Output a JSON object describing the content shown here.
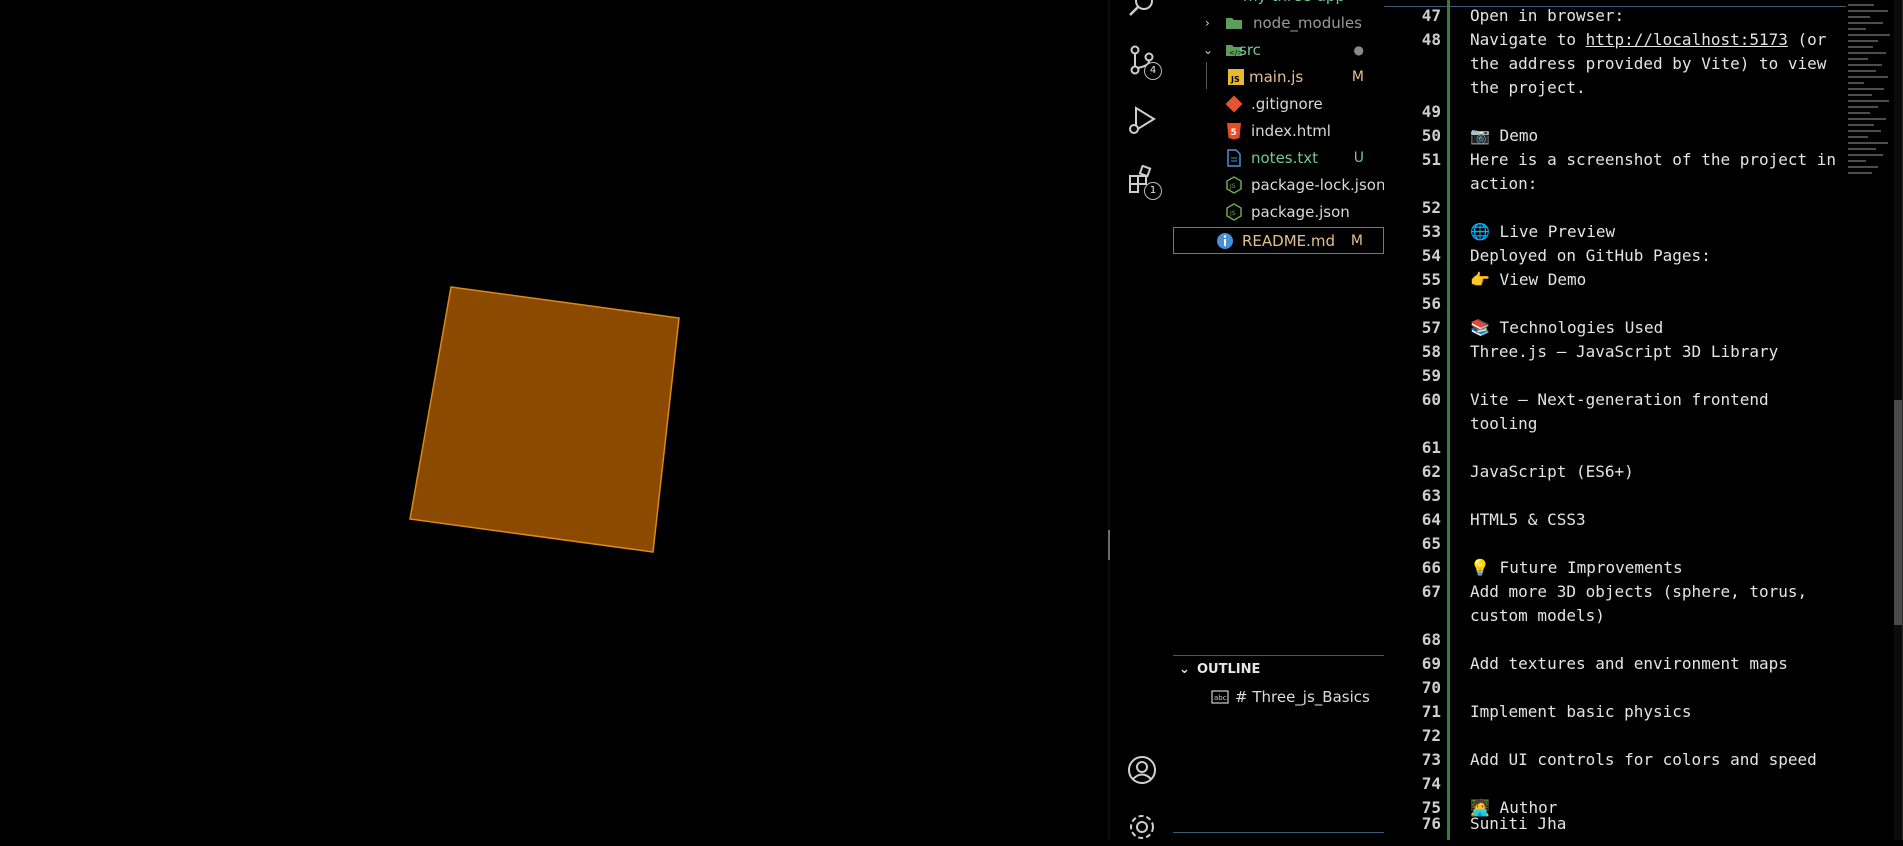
{
  "explorer": {
    "root_label": "my-three-app",
    "items": [
      {
        "label": "node_modules",
        "color": "#9a9a9a",
        "decoration": "",
        "kind": "folder"
      },
      {
        "label": "src",
        "color": "#73c991",
        "decoration": "●",
        "kind": "folder-open"
      },
      {
        "label": "main.js",
        "color": "#e2c08d",
        "decoration": "M",
        "kind": "js"
      },
      {
        "label": ".gitignore",
        "color": "#d8d8d8",
        "decoration": "",
        "kind": "git"
      },
      {
        "label": "index.html",
        "color": "#d8d8d8",
        "decoration": "",
        "kind": "html"
      },
      {
        "label": "notes.txt",
        "color": "#73c991",
        "decoration": "U",
        "kind": "txt"
      },
      {
        "label": "package-lock.json",
        "color": "#d8d8d8",
        "decoration": "",
        "kind": "json"
      },
      {
        "label": "package.json",
        "color": "#d8d8d8",
        "decoration": "",
        "kind": "json"
      },
      {
        "label": "README.md",
        "color": "#e2c08d",
        "decoration": "M",
        "kind": "info"
      }
    ],
    "outline_title": "OUTLINE",
    "outline_item": "# Three_js_Basics"
  },
  "activity": {
    "icons": [
      "search-icon",
      "source-control-icon",
      "run-debug-icon",
      "extensions-icon",
      "account-icon",
      "settings-gear-icon"
    ],
    "source_control_badge": "4",
    "extensions_badge": "1"
  },
  "editor": {
    "lines": [
      {
        "num": "47",
        "text": "Open in browser:"
      },
      {
        "num": "48",
        "pre": "Navigate to ",
        "link": "http://localhost:5173",
        "post": " (or the address provided by Vite) to view the project."
      },
      {
        "num": "49",
        "text": ""
      },
      {
        "num": "50",
        "text": "📷 Demo"
      },
      {
        "num": "51",
        "text": "Here is a screenshot of the project in action:"
      },
      {
        "num": "52",
        "text": ""
      },
      {
        "num": "53",
        "text": "🌐 Live Preview"
      },
      {
        "num": "54",
        "text": "Deployed on GitHub Pages:"
      },
      {
        "num": "55",
        "text": "👉 View Demo"
      },
      {
        "num": "56",
        "text": ""
      },
      {
        "num": "57",
        "text": "📚 Technologies Used"
      },
      {
        "num": "58",
        "text": "Three.js – JavaScript 3D Library"
      },
      {
        "num": "59",
        "text": ""
      },
      {
        "num": "60",
        "text": "Vite – Next-generation frontend tooling"
      },
      {
        "num": "61",
        "text": ""
      },
      {
        "num": "62",
        "text": "JavaScript (ES6+)"
      },
      {
        "num": "63",
        "text": ""
      },
      {
        "num": "64",
        "text": "HTML5 & CSS3"
      },
      {
        "num": "65",
        "text": ""
      },
      {
        "num": "66",
        "text": "💡 Future Improvements"
      },
      {
        "num": "67",
        "text": "Add more 3D objects (sphere, torus, custom models)"
      },
      {
        "num": "68",
        "text": ""
      },
      {
        "num": "69",
        "text": "Add textures and environment maps"
      },
      {
        "num": "70",
        "text": ""
      },
      {
        "num": "71",
        "text": "Implement basic physics"
      },
      {
        "num": "72",
        "text": ""
      },
      {
        "num": "73",
        "text": "Add UI controls for colors and speed"
      },
      {
        "num": "74",
        "text": ""
      },
      {
        "num": "75",
        "text": "🧑‍💻 Author"
      },
      {
        "num": "76",
        "text": "Suniti Jha"
      }
    ]
  },
  "scene": {
    "cube_color": "#8b4a00",
    "cube_edge_color": "#d98a1a"
  }
}
